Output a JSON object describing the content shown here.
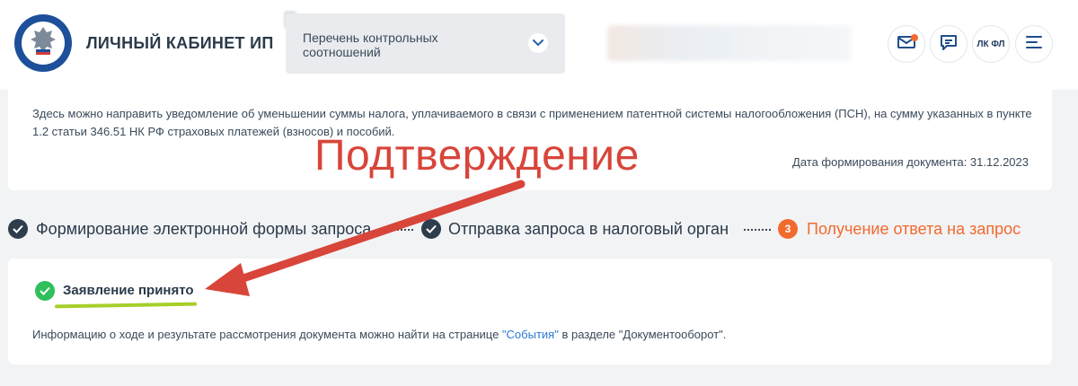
{
  "header": {
    "brand": "ЛИЧНЫЙ КАБИНЕТ ИП",
    "select_value": "Перечень контрольных соотношений",
    "icons": [
      "logo-emblem-icon",
      "chevron-down-icon",
      "mail-icon",
      "chat-icon",
      "menu-icon"
    ],
    "lkfl_label": "ЛК ФЛ"
  },
  "info": {
    "text": "Здесь можно направить уведомление об уменьшении суммы налога, уплачиваемого в связи с применением патентной системы налогообложения (ПСН), на сумму указанных в пункте 1.2 статьи 346.51 НК РФ страховых платежей (взносов) и пособий.",
    "date_label": "Дата формирования документа: 31.12.2023"
  },
  "steps": [
    {
      "label": "Формирование электронной формы запроса",
      "state": "done"
    },
    {
      "label": "Отправка запроса в налоговый орган",
      "state": "done"
    },
    {
      "label": "Получение ответа на запрос",
      "state": "active",
      "number": "3"
    }
  ],
  "result": {
    "status": "Заявление принято",
    "info_before": "Информацию о ходе и результате рассмотрения документа можно найти на странице ",
    "info_link": "\"События\"",
    "info_after": " в разделе \"Документооборот\"."
  },
  "annotation": {
    "text": "Подтверждение"
  },
  "colors": {
    "accent_orange": "#f26a2e",
    "success_green": "#2fbf5b",
    "link_blue": "#2a7bd4",
    "annotation_red": "#d8453a",
    "underline_green": "#a6cf2a"
  }
}
